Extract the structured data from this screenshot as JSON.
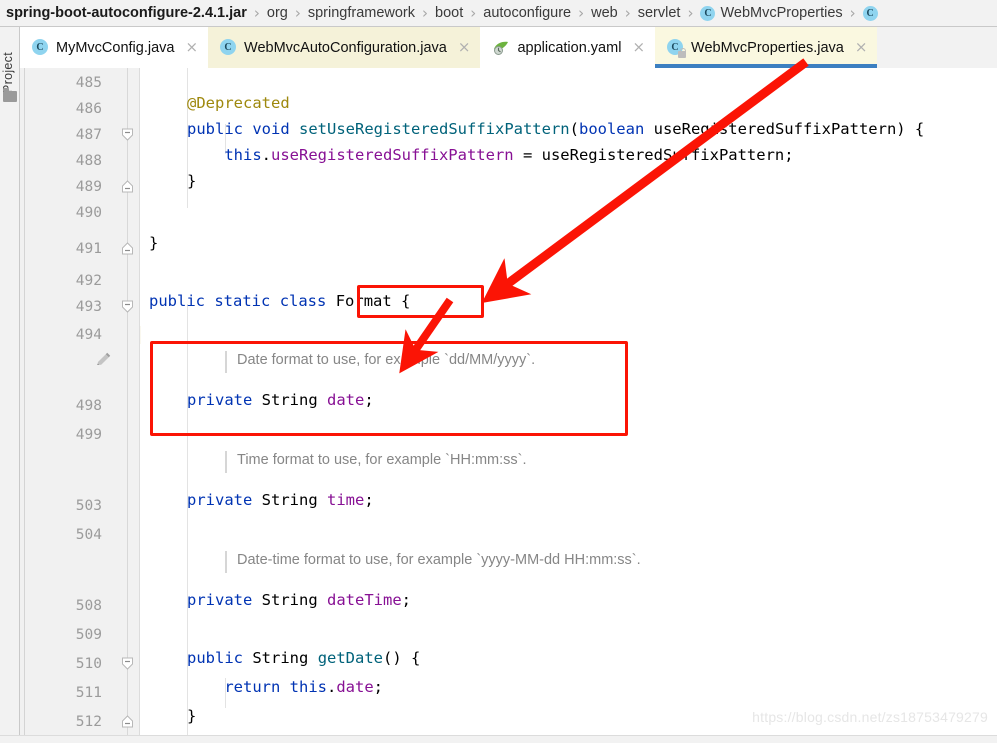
{
  "breadcrumb": {
    "separator": "›",
    "items": [
      {
        "label": "spring-boot-autoconfigure-2.4.1.jar",
        "icon": null,
        "bold": true
      },
      {
        "label": "org",
        "icon": null,
        "bold": false
      },
      {
        "label": "springframework",
        "icon": null,
        "bold": false
      },
      {
        "label": "boot",
        "icon": null,
        "bold": false
      },
      {
        "label": "autoconfigure",
        "icon": null,
        "bold": false
      },
      {
        "label": "web",
        "icon": null,
        "bold": false
      },
      {
        "label": "servlet",
        "icon": null,
        "bold": false
      },
      {
        "label": "WebMvcProperties",
        "icon": "java-class-icon",
        "bold": false
      },
      {
        "label": "",
        "icon": "java-class-icon",
        "bold": false
      }
    ]
  },
  "tabs": [
    {
      "label": "MyMvcConfig.java",
      "icon": "java-class-icon",
      "close": "×",
      "active": false,
      "bg": "bg-white"
    },
    {
      "label": "WebMvcAutoConfiguration.java",
      "icon": "java-class-icon",
      "close": "×",
      "active": false,
      "bg": "bg-cream"
    },
    {
      "label": "application.yaml",
      "icon": "spring-leaf-icon",
      "close": "×",
      "active": false,
      "bg": "bg-white"
    },
    {
      "label": "WebMvcProperties.java",
      "icon": "java-class-readonly-icon",
      "close": "×",
      "active": true,
      "bg": "bg-active"
    }
  ],
  "sidebar": {
    "project_label": "Project",
    "folder_icon": "folder-icon"
  },
  "editor": {
    "line_numbers": [
      "485",
      "486",
      "487",
      "488",
      "489",
      "490",
      "491",
      "492",
      "493",
      "494",
      "498",
      "499",
      "503",
      "504",
      "508",
      "509",
      "510",
      "511",
      "512"
    ],
    "code_lines": [
      {
        "n": "486",
        "text": "@Deprecated",
        "cls": "ann"
      },
      {
        "n": "487",
        "text": "public void setUseRegisteredSuffixPattern(boolean useRegisteredSuffixPattern) {"
      },
      {
        "n": "488",
        "text": "    this.useRegisteredSuffixPattern = useRegisteredSuffixPattern;"
      },
      {
        "n": "489",
        "text": "}"
      },
      {
        "n": "491",
        "text": "}"
      },
      {
        "n": "493",
        "text": "public static class Format {"
      },
      {
        "n": "498",
        "text": "private String date;"
      },
      {
        "n": "503",
        "text": "private String time;"
      },
      {
        "n": "508",
        "text": "private String dateTime;"
      },
      {
        "n": "510",
        "text": "public String getDate() {"
      },
      {
        "n": "511",
        "text": "    return this.date;"
      },
      {
        "n": "512",
        "text": "}"
      }
    ],
    "doc_comments": [
      "Date format to use, for example `dd/MM/yyyy`.",
      "Time format to use, for example `HH:mm:ss`.",
      "Date-time format to use, for example `yyyy-MM-dd HH:mm:ss`."
    ],
    "gutter_pencil_icon": "pencil-edit-icon"
  },
  "annotations": {
    "box_format_label": "Format {",
    "box_date_field_label": "private String date;",
    "accent_color": "#fb1405"
  },
  "watermark": "https://blog.csdn.net/zs18753479279"
}
